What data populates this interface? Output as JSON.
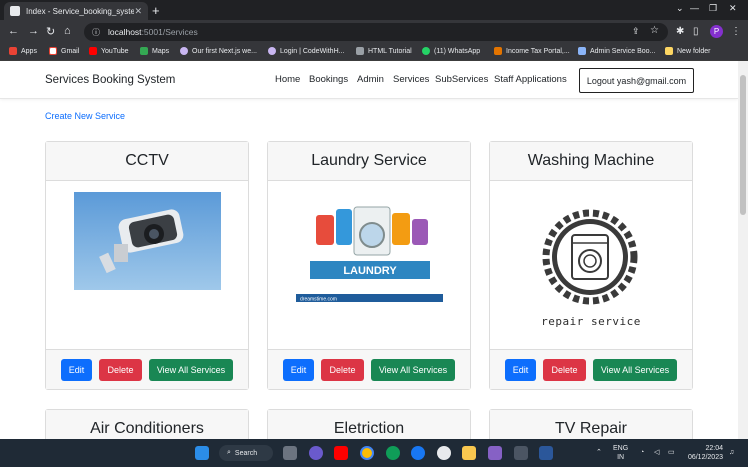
{
  "browser": {
    "tab_title": "Index - Service_booking_system",
    "url_host": "localhost",
    "url_path": ":5001/Services",
    "profile_initial": "P",
    "bookmarks": [
      "Apps",
      "Gmail",
      "YouTube",
      "Maps",
      "Our first Next.js we...",
      "Login | CodeWithH...",
      "HTML Tutorial",
      "(11) WhatsApp",
      "Income Tax Portal,...",
      "Admin Service Boo...",
      "New folder"
    ]
  },
  "navbar": {
    "brand": "Services Booking System",
    "links": [
      "Home",
      "Bookings",
      "Admin",
      "Services",
      "SubServices",
      "Staff Applications"
    ],
    "logout": "Logout yash@gmail.com"
  },
  "create_link": "Create New Service",
  "cards": [
    {
      "title": "CCTV"
    },
    {
      "title": "Laundry Service",
      "image_text": "LAUNDRY",
      "image_footer": "dreamstime.com"
    },
    {
      "title": "Washing Machine",
      "image_caption": "repair service"
    },
    {
      "title": "Air Conditioners"
    },
    {
      "title": "Eletriction"
    },
    {
      "title": "TV Repair"
    }
  ],
  "buttons": {
    "edit": "Edit",
    "delete": "Delete",
    "view_all": "View All Services"
  },
  "taskbar": {
    "search": "Search",
    "lang_top": "ENG",
    "lang_bottom": "IN",
    "time": "22:04",
    "date": "06/12/2023"
  },
  "colors": {
    "primary": "#0d6efd",
    "danger": "#dc3545",
    "success": "#198754",
    "link": "#0d6efd"
  }
}
